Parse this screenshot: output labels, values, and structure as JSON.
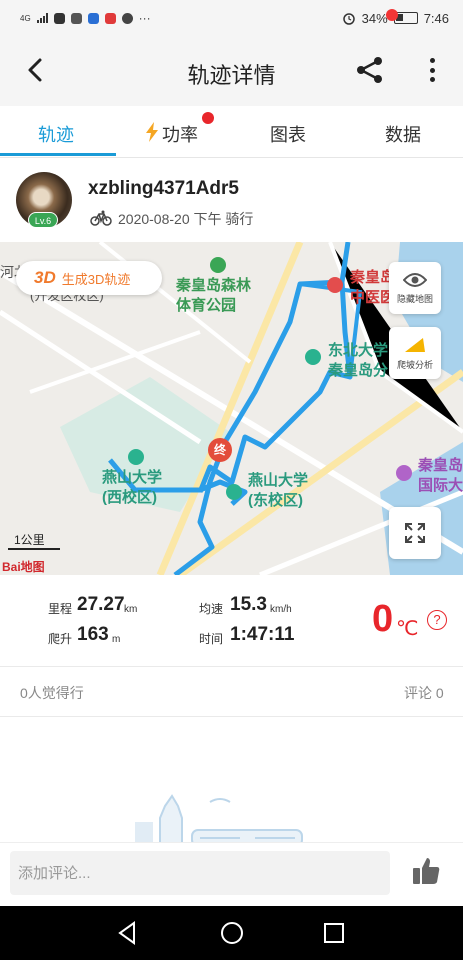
{
  "status_bar": {
    "network": "4G",
    "battery_percent": "34%",
    "time": "7:46",
    "more": "···"
  },
  "header": {
    "title": "轨迹详情"
  },
  "tabs": [
    {
      "label": "轨迹"
    },
    {
      "label": "功率"
    },
    {
      "label": "图表"
    },
    {
      "label": "数据"
    }
  ],
  "user": {
    "name": "xzbling4371Adr5",
    "level": "Lv.6",
    "date": "2020-08-20 下午 骑行"
  },
  "map": {
    "btn_3d_icon": "3D",
    "btn_3d_label": "生成3D轨迹",
    "hide_map_label": "隐藏地图",
    "climb_label": "爬坡分析",
    "end_marker": "终",
    "labels": {
      "forest_park": "秦皇岛森林\n体育公园",
      "yanshan_west": "燕山大学\n(西校区)",
      "yanshan_east": "燕山大学\n(东校区)",
      "neu": "东北大学\n秦皇岛分",
      "hospital": "秦皇岛\n中医医",
      "intl": "秦皇岛\n国际大",
      "hebei": "河北",
      "campus": "(开发区校区)"
    },
    "scale": "1公里",
    "provider": "Bai地图"
  },
  "stats": {
    "distance_label": "里程",
    "distance_value": "27.27",
    "distance_unit": "km",
    "avg_speed_label": "均速",
    "avg_speed_value": "15.3",
    "avg_speed_unit": "km/h",
    "climb_label": "爬升",
    "climb_value": "163",
    "climb_unit": "m",
    "time_label": "时间",
    "time_value": "1:47:11",
    "temperature_value": "0",
    "temperature_unit": "℃",
    "help": "?"
  },
  "social": {
    "likes": "0人觉得行",
    "comments": "评论 0"
  },
  "comment_bar": {
    "placeholder": "添加评论..."
  },
  "colors": {
    "accent": "#1a9bd7",
    "route": "#2b9ee8",
    "red": "#e8262b",
    "orange": "#f07a2d"
  }
}
